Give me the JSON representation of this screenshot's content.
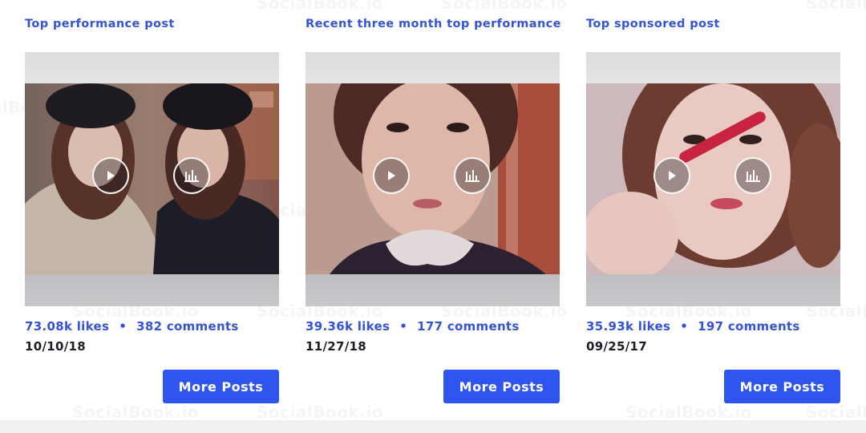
{
  "watermark_text": "SocialBook.io",
  "cards": [
    {
      "title": "Top performance post",
      "likes": "73.08k likes",
      "separator": "•",
      "comments": "382 comments",
      "date": "10/10/18",
      "button_label": "More Posts"
    },
    {
      "title": "Recent three month top performance",
      "likes": "39.36k likes",
      "separator": "•",
      "comments": "177 comments",
      "date": "11/27/18",
      "button_label": "More Posts"
    },
    {
      "title": "Top sponsored post",
      "likes": "35.93k likes",
      "separator": "•",
      "comments": "197 comments",
      "date": "09/25/17",
      "button_label": "More Posts"
    }
  ],
  "icons": {
    "play": "play-icon",
    "stats": "bar-chart-icon"
  },
  "colors": {
    "accent_text": "#3553d6",
    "button_bg": "#2f55f0",
    "date_text": "#1c1c2a"
  }
}
